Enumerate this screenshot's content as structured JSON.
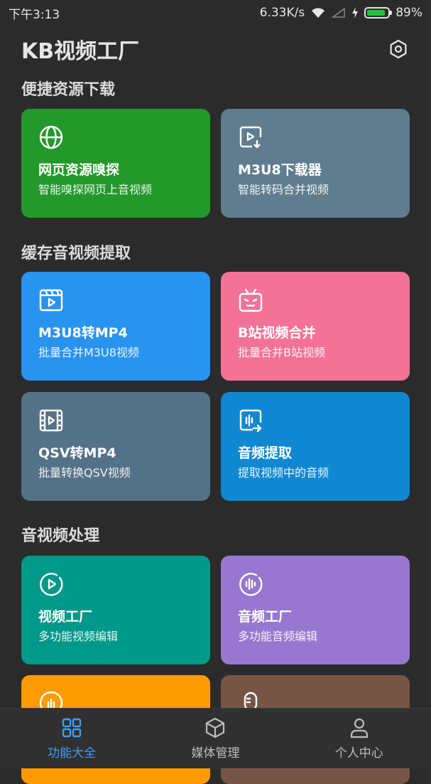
{
  "status": {
    "time": "下午3:13",
    "speed": "6.33K/s",
    "battery": "89%",
    "battery_level": 0.89
  },
  "app": {
    "title": "KB视频工厂"
  },
  "sections": [
    {
      "title": "便捷资源下载"
    },
    {
      "title": "缓存音视频提取"
    },
    {
      "title": "音视频处理"
    }
  ],
  "cards": [
    {
      "title": "网页资源嗅探",
      "sub": "智能嗅探网页上音视频",
      "color": "#23992b",
      "icon": "globe-icon"
    },
    {
      "title": "M3U8下载器",
      "sub": "智能转码合并视频",
      "color": "#5f7d8f",
      "icon": "video-download-icon"
    },
    {
      "title": "M3U8转MP4",
      "sub": "批量合并M3U8视频",
      "color": "#2993f0",
      "icon": "clapperboard-icon"
    },
    {
      "title": "B站视频合并",
      "sub": "批量合并B站视频",
      "color": "#f47298",
      "icon": "bilibili-icon"
    },
    {
      "title": "QSV转MP4",
      "sub": "批量转换QSV视频",
      "color": "#547287",
      "icon": "film-icon"
    },
    {
      "title": "音频提取",
      "sub": "提取视频中的音频",
      "color": "#0f88d1",
      "icon": "audio-extract-icon"
    },
    {
      "title": "视频工厂",
      "sub": "多功能视频编辑",
      "color": "#009888",
      "icon": "play-circle-icon"
    },
    {
      "title": "音频工厂",
      "sub": "多功能音频编辑",
      "color": "#9777cf",
      "icon": "audio-wave-icon"
    },
    {
      "title": "",
      "sub": "",
      "color": "#fe9b00",
      "icon": "podcast-icon"
    },
    {
      "title": "",
      "sub": "",
      "color": "#775546",
      "icon": "microphone-icon"
    }
  ],
  "nav": [
    {
      "label": "功能大全",
      "icon": "grid-icon",
      "active": true
    },
    {
      "label": "媒体管理",
      "icon": "cube-icon",
      "active": false
    },
    {
      "label": "个人中心",
      "icon": "person-icon",
      "active": false
    }
  ],
  "colors": {
    "accent": "#3d9df3",
    "background": "#2b2b2b"
  }
}
